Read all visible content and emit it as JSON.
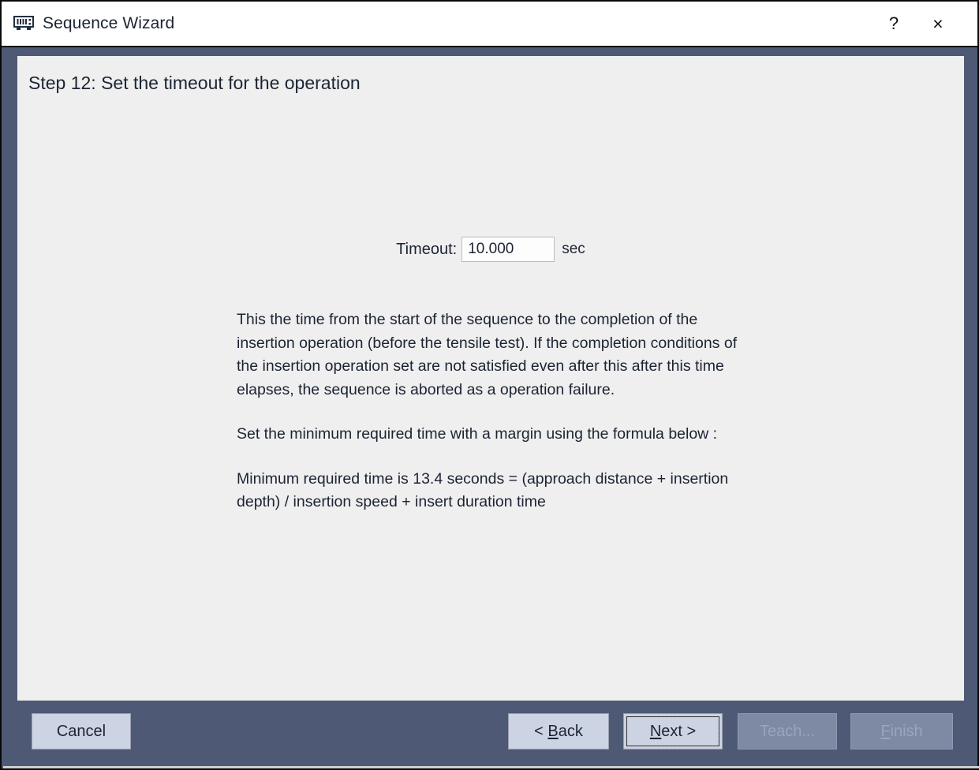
{
  "window": {
    "title": "Sequence Wizard",
    "icon": "memory-chip-icon",
    "help_label": "?",
    "close_label": "×",
    "frame_color": "#4e5a75",
    "panel_color": "#efefef",
    "text_color": "#1c2433"
  },
  "step": {
    "title": "Step 12: Set the timeout for the operation"
  },
  "timeout": {
    "label": "Timeout:",
    "value": "10.000",
    "placeholder": "0.000",
    "unit": "sec"
  },
  "description": {
    "paragraph_1": "This the time from the start of the sequence to the completion of the insertion operation (before the tensile test).  If the completion conditions of the insertion operation set are not satisfied even after this after this time elapses, the sequence is aborted as a operation failure.",
    "paragraph_2": "Set the minimum required time with a margin using the formula below :",
    "paragraph_3": "Minimum required time is 13.4 seconds = (approach distance + insertion depth) / insertion speed + insert duration time"
  },
  "buttons": {
    "cancel": {
      "label": "Cancel",
      "disabled": false,
      "focused": false
    },
    "back": {
      "label": "< Back",
      "accel": "B",
      "disabled": false,
      "focused": false
    },
    "next": {
      "label": "Next >",
      "accel": "N",
      "disabled": false,
      "focused": true
    },
    "teach": {
      "label": "Teach...",
      "disabled": true,
      "focused": false
    },
    "finish": {
      "label": "Finish",
      "accel": "F",
      "disabled": true,
      "focused": false
    }
  }
}
